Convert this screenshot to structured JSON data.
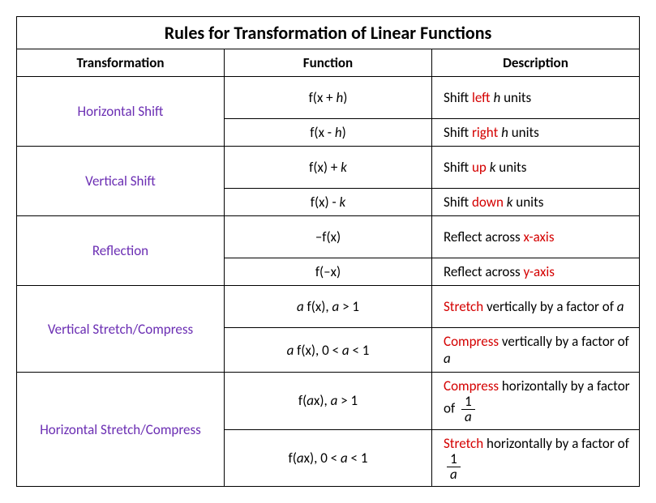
{
  "title": "Rules for Transformation of Linear Functions",
  "headers": {
    "transformation": "Transformation",
    "function": "Function",
    "description": "Description"
  },
  "rows": [
    {
      "name": "Horizontal Shift",
      "sub": [
        {
          "func_pre": "f(x + ",
          "func_var": "h",
          "func_post": ")",
          "desc_pre": "Shift ",
          "desc_red": "left",
          "desc_mid": " ",
          "desc_var": "h",
          "desc_post": " units"
        },
        {
          "func_pre": "f(x  - ",
          "func_var": "h",
          "func_post": ")",
          "desc_pre": "Shift ",
          "desc_red": "right",
          "desc_mid": " ",
          "desc_var": "h",
          "desc_post": " units"
        }
      ]
    },
    {
      "name": "Vertical Shift",
      "sub": [
        {
          "func_pre": "f(x) + ",
          "func_var": "k",
          "func_post": "",
          "desc_pre": "Shift ",
          "desc_red": "up",
          "desc_mid": " ",
          "desc_var": "k",
          "desc_post": " units"
        },
        {
          "func_pre": "f(x) - ",
          "func_var": "k",
          "func_post": "",
          "desc_pre": "Shift ",
          "desc_red": "down",
          "desc_mid": " ",
          "desc_var": "k",
          "desc_post": " units"
        }
      ]
    },
    {
      "name": "Reflection",
      "sub": [
        {
          "func_full": "–f(x)",
          "desc_pre": "Reflect across ",
          "desc_red": "x-axis",
          "desc_post": ""
        },
        {
          "func_full": "f(–x)",
          "desc_pre": "Reflect across ",
          "desc_red": "y-axis",
          "desc_post": ""
        }
      ]
    },
    {
      "name": "Vertical Stretch/Compress",
      "sub": [
        {
          "func_var_pre": "a",
          "func_mid": " f(x), ",
          "func_var_mid": "a",
          "func_end": " > 1",
          "desc_red": "Stretch",
          "desc_mid": " vertically by a factor of ",
          "desc_var": "a",
          "desc_post": ""
        },
        {
          "func_var_pre": "a",
          "func_mid": " f(x), 0 < ",
          "func_var_mid": "a",
          "func_end": " < 1",
          "desc_red": "Compress",
          "desc_mid": " vertically by a factor of ",
          "desc_var": "a",
          "desc_post": ""
        }
      ]
    },
    {
      "name": "Horizontal Stretch/Compress",
      "sub": [
        {
          "func_pre": "f(",
          "func_var_pre": "a",
          "func_mid": "x), ",
          "func_var_mid": "a",
          "func_end": " > 1",
          "desc_red": "Compress",
          "desc_mid": " horizontally by a factor of ",
          "frac_num": "1",
          "frac_den": "a"
        },
        {
          "func_pre": "f(",
          "func_var_pre": "a",
          "func_mid": "x), 0 < ",
          "func_var_mid": "a",
          "func_end": " < 1",
          "desc_red": "Stretch",
          "desc_mid": " horizontally by a factor of ",
          "frac_num": "1",
          "frac_den": "a"
        }
      ]
    }
  ]
}
